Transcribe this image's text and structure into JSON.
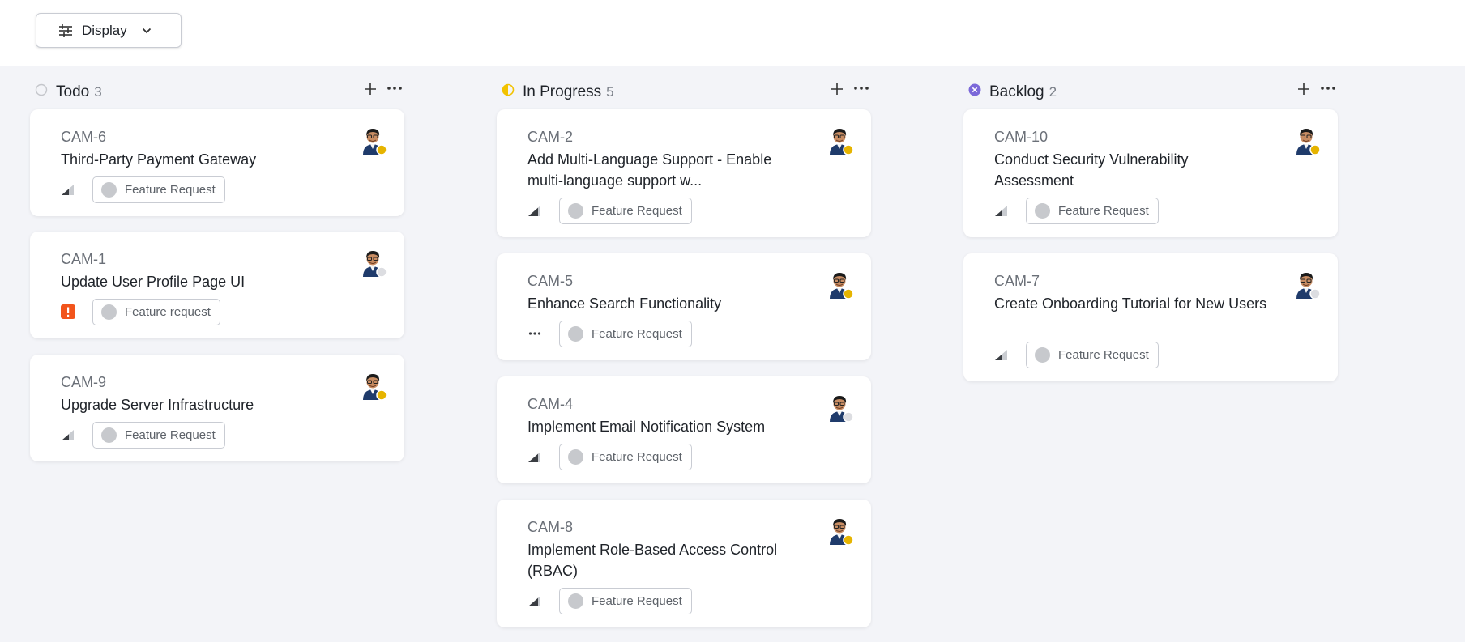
{
  "toolbar": {
    "display_label": "Display"
  },
  "columns": [
    {
      "title": "Todo",
      "count": "3",
      "status": "todo",
      "cards": [
        {
          "id": "CAM-6",
          "title": "Third-Party Payment Gateway",
          "priority": "medium",
          "tag": "Feature Request",
          "assignee_status": "away"
        },
        {
          "id": "CAM-1",
          "title": "Update User Profile Page UI",
          "priority": "urgent",
          "tag": "Feature request",
          "assignee_status": "offline"
        },
        {
          "id": "CAM-9",
          "title": "Upgrade Server Infrastructure",
          "priority": "medium",
          "tag": "Feature Request",
          "assignee_status": "away"
        }
      ]
    },
    {
      "title": "In Progress",
      "count": "5",
      "status": "in-progress",
      "cards": [
        {
          "id": "CAM-2",
          "title": "Add Multi-Language Support - Enable multi-language support w...",
          "priority": "high",
          "tag": "Feature Request",
          "assignee_status": "away"
        },
        {
          "id": "CAM-5",
          "title": "Enhance Search Functionality",
          "priority": "none",
          "tag": "Feature Request",
          "assignee_status": "away"
        },
        {
          "id": "CAM-4",
          "title": "Implement Email Notification System",
          "priority": "high",
          "tag": "Feature Request",
          "assignee_status": "offline"
        },
        {
          "id": "CAM-8",
          "title": "Implement Role-Based Access Control (RBAC)",
          "priority": "high",
          "tag": "Feature Request",
          "assignee_status": "away"
        }
      ]
    },
    {
      "title": "Backlog",
      "count": "2",
      "status": "backlog",
      "cards": [
        {
          "id": "CAM-10",
          "title": "Conduct Security Vulnerability Assessment",
          "priority": "medium",
          "tag": "Feature Request",
          "assignee_status": "away"
        },
        {
          "id": "CAM-7",
          "title": "Create Onboarding Tutorial for New Users",
          "priority": "medium",
          "tag": "Feature Request",
          "assignee_status": "offline"
        }
      ]
    }
  ],
  "colors": {
    "in_progress": "#f2c200",
    "backlog": "#7b68d9",
    "urgent": "#f2541b",
    "away": "#e6b400",
    "offline": "#dcdde1"
  }
}
